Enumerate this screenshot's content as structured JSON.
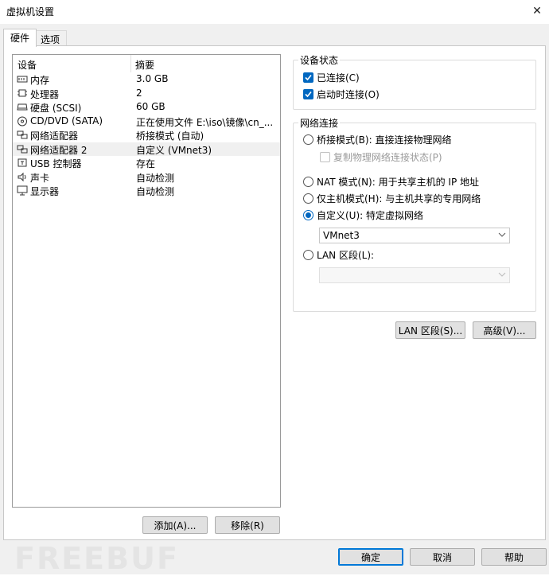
{
  "window": {
    "title": "虚拟机设置",
    "close_glyph": "✕"
  },
  "tabs": [
    {
      "label": "硬件"
    },
    {
      "label": "选项"
    }
  ],
  "device_list": {
    "col_device": "设备",
    "col_summary": "摘要",
    "rows": [
      {
        "name": "内存",
        "summary": "3.0 GB",
        "icon": "memory-icon"
      },
      {
        "name": "处理器",
        "summary": "2",
        "icon": "cpu-icon"
      },
      {
        "name": "硬盘 (SCSI)",
        "summary": "60 GB",
        "icon": "hard-disk-icon"
      },
      {
        "name": "CD/DVD (SATA)",
        "summary": "正在使用文件 E:\\iso\\镜像\\cn_...",
        "icon": "cd-dvd-icon"
      },
      {
        "name": "网络适配器",
        "summary": "桥接模式 (自动)",
        "icon": "network-adapter-icon"
      },
      {
        "name": "网络适配器 2",
        "summary": "自定义 (VMnet3)",
        "icon": "network-adapter-icon"
      },
      {
        "name": "USB 控制器",
        "summary": "存在",
        "icon": "usb-icon"
      },
      {
        "name": "声卡",
        "summary": "自动检测",
        "icon": "sound-card-icon"
      },
      {
        "name": "显示器",
        "summary": "自动检测",
        "icon": "monitor-icon"
      }
    ],
    "selected_index": 5
  },
  "device_buttons": {
    "add": "添加(A)...",
    "remove": "移除(R)"
  },
  "device_status": {
    "title": "设备状态",
    "connected": {
      "label": "已连接(C)",
      "checked": true
    },
    "connect_at_power_on": {
      "label": "启动时连接(O)",
      "checked": true
    }
  },
  "network_connection": {
    "title": "网络连接",
    "bridged": {
      "label": "桥接模式(B): 直接连接物理网络",
      "selected": false
    },
    "replicate": {
      "label": "复制物理网络连接状态(P)",
      "checked": false
    },
    "nat": {
      "label": "NAT 模式(N): 用于共享主机的 IP 地址",
      "selected": false
    },
    "host_only": {
      "label": "仅主机模式(H): 与主机共享的专用网络",
      "selected": false
    },
    "custom": {
      "label": "自定义(U): 特定虚拟网络",
      "selected": true
    },
    "custom_value": "VMnet3",
    "lan_segment": {
      "label": "LAN 区段(L):",
      "selected": false
    },
    "lan_segment_value": ""
  },
  "network_buttons": {
    "lan_segments": "LAN 区段(S)...",
    "advanced": "高级(V)..."
  },
  "footer": {
    "ok": "确定",
    "cancel": "取消",
    "help": "帮助"
  },
  "watermark": "FREEBUF",
  "colors": {
    "accent": "#0067c0",
    "primary_border": "#0078d7"
  }
}
